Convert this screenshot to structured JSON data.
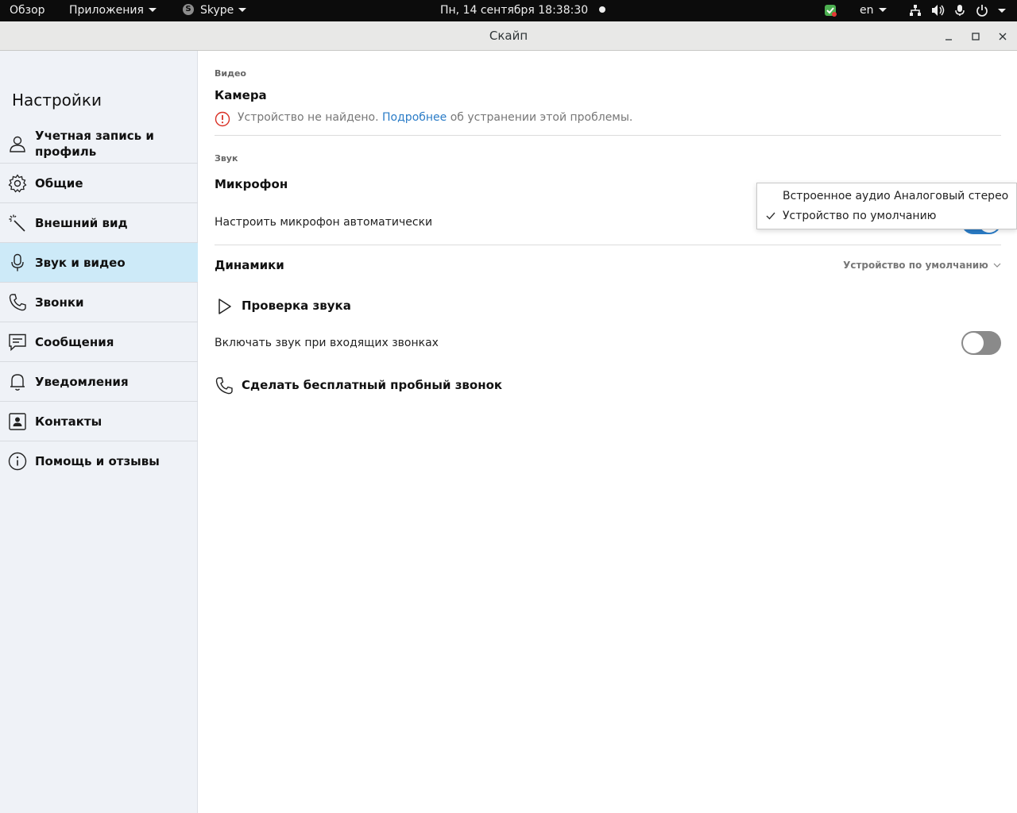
{
  "topbar": {
    "activities": "Обзор",
    "applications": "Приложения",
    "app_menu": "Skype",
    "clock": "Пн, 14 сентября  18:38:30",
    "lang": "en"
  },
  "window": {
    "title": "Скайп"
  },
  "sidebar": {
    "title": "Настройки",
    "items": [
      {
        "label": "Учетная запись и профиль",
        "icon": "person-icon"
      },
      {
        "label": "Общие",
        "icon": "gear-icon"
      },
      {
        "label": "Внешний вид",
        "icon": "magic-wand-icon"
      },
      {
        "label": "Звук и видео",
        "icon": "microphone-icon",
        "active": true
      },
      {
        "label": "Звонки",
        "icon": "phone-icon"
      },
      {
        "label": "Сообщения",
        "icon": "chat-icon"
      },
      {
        "label": "Уведомления",
        "icon": "bell-icon"
      },
      {
        "label": "Контакты",
        "icon": "contact-card-icon"
      },
      {
        "label": "Помощь и отзывы",
        "icon": "info-icon"
      }
    ]
  },
  "main": {
    "video_section": "Видео",
    "camera_title": "Камера",
    "camera_warning_prefix": "Устройство не найдено.",
    "camera_warning_link": "Подробнее",
    "camera_warning_suffix": "об устранении этой проблемы.",
    "audio_section": "Звук",
    "microphone_title": "Микрофон",
    "auto_mic_label": "Настроить микрофон автоматически",
    "auto_mic_on": true,
    "speakers_title": "Динамики",
    "speakers_value": "Устройство по умолчанию",
    "sound_test": "Проверка звука",
    "incoming_sound_label": "Включать звук при входящих звонках",
    "incoming_sound_on": false,
    "test_call": "Сделать бесплатный пробный звонок"
  },
  "mic_dropdown": {
    "options": [
      {
        "label": "Встроенное аудио Аналоговый стерео",
        "selected": false
      },
      {
        "label": "Устройство по умолчанию",
        "selected": true
      }
    ]
  },
  "colors": {
    "accent": "#2a7cc7",
    "active_nav": "#cdeaf8",
    "sidebar_bg": "#eff2f7",
    "warning": "#d93025"
  }
}
